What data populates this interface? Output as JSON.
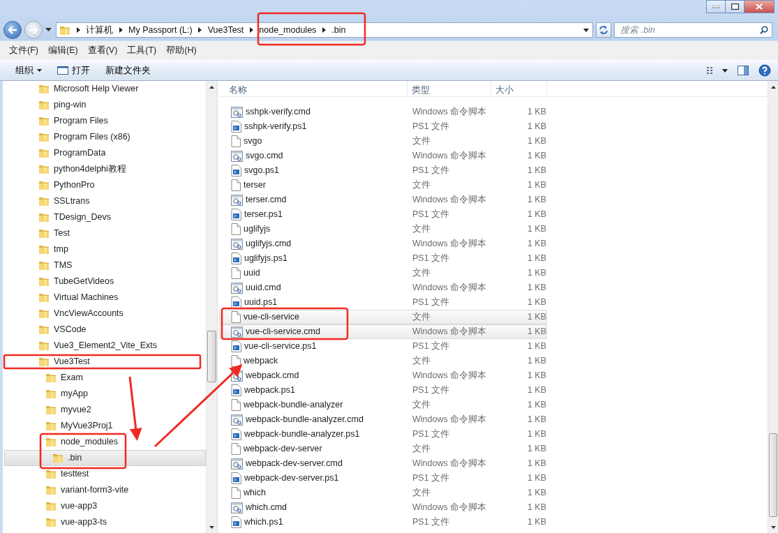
{
  "address_bar": {
    "segments": [
      "计算机",
      "My Passport (L:)",
      "Vue3Test",
      "node_modules",
      ".bin"
    ]
  },
  "search": {
    "placeholder": "搜索 .bin"
  },
  "menu": [
    "文件(F)",
    "编辑(E)",
    "查看(V)",
    "工具(T)",
    "帮助(H)"
  ],
  "toolbar": [
    {
      "label": "组织",
      "kind": "dropdown"
    },
    {
      "label": "打开",
      "kind": "open"
    },
    {
      "label": "新建文件夹",
      "kind": "plain"
    }
  ],
  "tree": [
    {
      "label": "Microsoft Help Viewer",
      "selected": false
    },
    {
      "label": "ping-win",
      "selected": false
    },
    {
      "label": "Program Files",
      "selected": false
    },
    {
      "label": "Program Files (x86)",
      "selected": false
    },
    {
      "label": "ProgramData",
      "selected": false
    },
    {
      "label": "python4delphi教程",
      "selected": false
    },
    {
      "label": "PythonPro",
      "selected": false
    },
    {
      "label": "SSLtrans",
      "selected": false
    },
    {
      "label": "TDesign_Devs",
      "selected": false
    },
    {
      "label": "Test",
      "selected": false
    },
    {
      "label": "tmp",
      "selected": false
    },
    {
      "label": "TMS",
      "selected": false
    },
    {
      "label": "TubeGetVideos",
      "selected": false
    },
    {
      "label": "Virtual Machines",
      "selected": false
    },
    {
      "label": "VncViewAccounts",
      "selected": false
    },
    {
      "label": "VSCode",
      "selected": false
    },
    {
      "label": "Vue3_Element2_Vite_Exts",
      "selected": false
    },
    {
      "label": "Vue3Test",
      "selected": false,
      "children": [
        {
          "label": "Exam",
          "selected": false
        },
        {
          "label": "myApp",
          "selected": false
        },
        {
          "label": "myvue2",
          "selected": false
        },
        {
          "label": "MyVue3Proj1",
          "selected": false
        },
        {
          "label": "node_modules",
          "selected": false,
          "children": [
            {
              "label": ".bin",
              "selected": true
            }
          ]
        },
        {
          "label": "testtest",
          "selected": false
        },
        {
          "label": "variant-form3-vite",
          "selected": false
        },
        {
          "label": "vue-app3",
          "selected": false
        },
        {
          "label": "vue-app3-ts",
          "selected": false
        }
      ]
    }
  ],
  "file_list": {
    "columns": [
      "名称",
      "类型",
      "大小"
    ],
    "rows": [
      {
        "name": "sshpk-verify.cmd",
        "type": "Windows 命令脚本",
        "size": "1 KB",
        "kind": "cmd",
        "selected": false
      },
      {
        "name": "sshpk-verify.ps1",
        "type": "PS1 文件",
        "size": "1 KB",
        "kind": "ps1",
        "selected": false
      },
      {
        "name": "svgo",
        "type": "文件",
        "size": "1 KB",
        "kind": "file",
        "selected": false
      },
      {
        "name": "svgo.cmd",
        "type": "Windows 命令脚本",
        "size": "1 KB",
        "kind": "cmd",
        "selected": false
      },
      {
        "name": "svgo.ps1",
        "type": "PS1 文件",
        "size": "1 KB",
        "kind": "ps1",
        "selected": false
      },
      {
        "name": "terser",
        "type": "文件",
        "size": "1 KB",
        "kind": "file",
        "selected": false
      },
      {
        "name": "terser.cmd",
        "type": "Windows 命令脚本",
        "size": "1 KB",
        "kind": "cmd",
        "selected": false
      },
      {
        "name": "terser.ps1",
        "type": "PS1 文件",
        "size": "1 KB",
        "kind": "ps1",
        "selected": false
      },
      {
        "name": "uglifyjs",
        "type": "文件",
        "size": "1 KB",
        "kind": "file",
        "selected": false
      },
      {
        "name": "uglifyjs.cmd",
        "type": "Windows 命令脚本",
        "size": "1 KB",
        "kind": "cmd",
        "selected": false
      },
      {
        "name": "uglifyjs.ps1",
        "type": "PS1 文件",
        "size": "1 KB",
        "kind": "ps1",
        "selected": false
      },
      {
        "name": "uuid",
        "type": "文件",
        "size": "1 KB",
        "kind": "file",
        "selected": false
      },
      {
        "name": "uuid.cmd",
        "type": "Windows 命令脚本",
        "size": "1 KB",
        "kind": "cmd",
        "selected": false
      },
      {
        "name": "uuid.ps1",
        "type": "PS1 文件",
        "size": "1 KB",
        "kind": "ps1",
        "selected": false
      },
      {
        "name": "vue-cli-service",
        "type": "文件",
        "size": "1 KB",
        "kind": "file",
        "selected": true
      },
      {
        "name": "vue-cli-service.cmd",
        "type": "Windows 命令脚本",
        "size": "1 KB",
        "kind": "cmd",
        "selected": true
      },
      {
        "name": "vue-cli-service.ps1",
        "type": "PS1 文件",
        "size": "1 KB",
        "kind": "ps1",
        "selected": false
      },
      {
        "name": "webpack",
        "type": "文件",
        "size": "1 KB",
        "kind": "file",
        "selected": false
      },
      {
        "name": "webpack.cmd",
        "type": "Windows 命令脚本",
        "size": "1 KB",
        "kind": "cmd",
        "selected": false
      },
      {
        "name": "webpack.ps1",
        "type": "PS1 文件",
        "size": "1 KB",
        "kind": "ps1",
        "selected": false
      },
      {
        "name": "webpack-bundle-analyzer",
        "type": "文件",
        "size": "1 KB",
        "kind": "file",
        "selected": false
      },
      {
        "name": "webpack-bundle-analyzer.cmd",
        "type": "Windows 命令脚本",
        "size": "1 KB",
        "kind": "cmd",
        "selected": false
      },
      {
        "name": "webpack-bundle-analyzer.ps1",
        "type": "PS1 文件",
        "size": "1 KB",
        "kind": "ps1",
        "selected": false
      },
      {
        "name": "webpack-dev-server",
        "type": "文件",
        "size": "1 KB",
        "kind": "file",
        "selected": false
      },
      {
        "name": "webpack-dev-server.cmd",
        "type": "Windows 命令脚本",
        "size": "1 KB",
        "kind": "cmd",
        "selected": false
      },
      {
        "name": "webpack-dev-server.ps1",
        "type": "PS1 文件",
        "size": "1 KB",
        "kind": "ps1",
        "selected": false
      },
      {
        "name": "which",
        "type": "文件",
        "size": "1 KB",
        "kind": "file",
        "selected": false
      },
      {
        "name": "which.cmd",
        "type": "Windows 命令脚本",
        "size": "1 KB",
        "kind": "cmd",
        "selected": false
      },
      {
        "name": "which.ps1",
        "type": "PS1 文件",
        "size": "1 KB",
        "kind": "ps1",
        "selected": false
      }
    ]
  }
}
